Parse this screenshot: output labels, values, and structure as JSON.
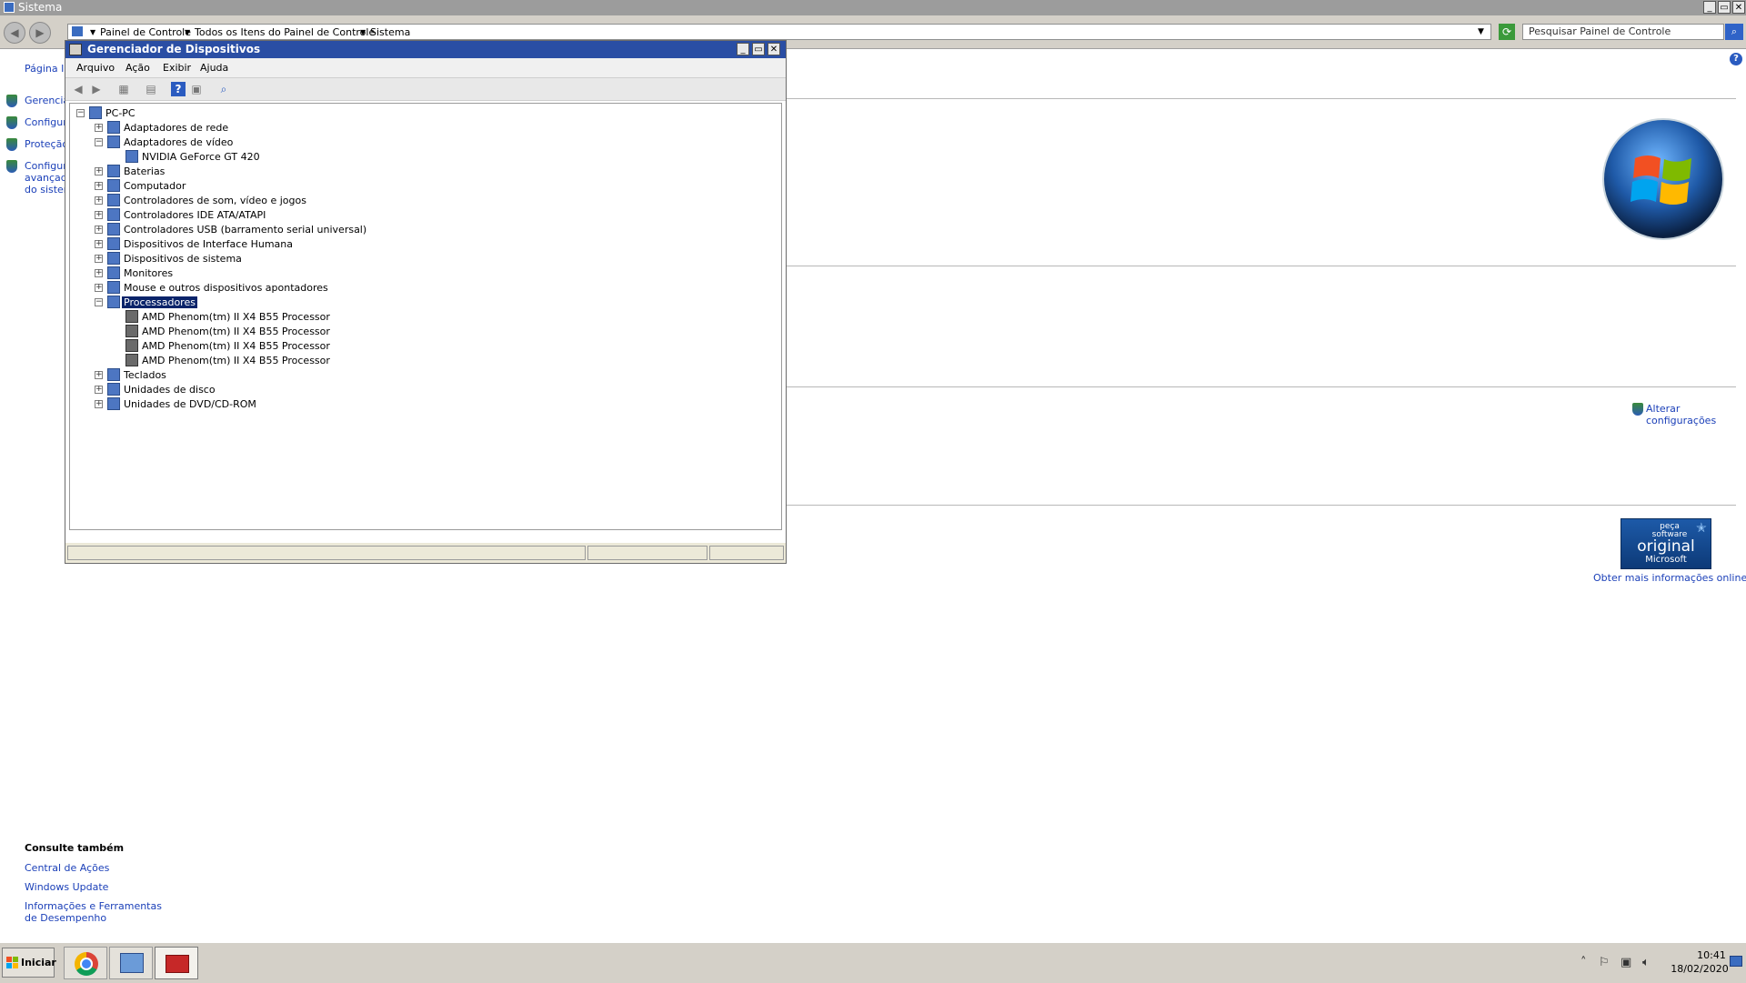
{
  "window": {
    "title": "Sistema",
    "min": "_",
    "max": "▭",
    "close": "✕"
  },
  "addressbar": {
    "back": "◀",
    "forward": "▶",
    "crumbs": [
      "Painel de Controle",
      "Todos os Itens do Painel de Controle",
      "Sistema"
    ],
    "search_placeholder": "Pesquisar Painel de Controle"
  },
  "sidebar": {
    "home": "Página Inicial do Painel de Controle",
    "items": [
      {
        "label": "Gerenciador de Dispositivos"
      },
      {
        "label": "Configurações remotas"
      },
      {
        "label": "Proteção do sistema"
      },
      {
        "label": "Configurações avançadas do sistema"
      }
    ]
  },
  "seealso": {
    "heading": "Consulte também",
    "links": [
      "Central de Ações",
      "Windows Update",
      "Informações e Ferramentas de Desempenho"
    ]
  },
  "right": {
    "change_settings": "Alterar configurações",
    "genuine_top": "peça software",
    "genuine_main": "original",
    "genuine_brand": "Microsoft",
    "more_info": "Obter mais informações online..."
  },
  "devmgr": {
    "title": "Gerenciador de Dispositivos",
    "menus": [
      "Arquivo",
      "Ação",
      "Exibir",
      "Ajuda"
    ],
    "tree": [
      {
        "label": "PC-PC",
        "level": 0,
        "exp": "−"
      },
      {
        "label": "Adaptadores de rede",
        "level": 1,
        "exp": "+"
      },
      {
        "label": "Adaptadores de vídeo",
        "level": 1,
        "exp": "−"
      },
      {
        "label": "NVIDIA GeForce GT 420",
        "level": 2,
        "exp": ""
      },
      {
        "label": "Baterias",
        "level": 1,
        "exp": "+"
      },
      {
        "label": "Computador",
        "level": 1,
        "exp": "+"
      },
      {
        "label": "Controladores de som, vídeo e jogos",
        "level": 1,
        "exp": "+"
      },
      {
        "label": "Controladores IDE ATA/ATAPI",
        "level": 1,
        "exp": "+"
      },
      {
        "label": "Controladores USB (barramento serial universal)",
        "level": 1,
        "exp": "+"
      },
      {
        "label": "Dispositivos de Interface Humana",
        "level": 1,
        "exp": "+"
      },
      {
        "label": "Dispositivos de sistema",
        "level": 1,
        "exp": "+"
      },
      {
        "label": "Monitores",
        "level": 1,
        "exp": "+"
      },
      {
        "label": "Mouse e outros dispositivos apontadores",
        "level": 1,
        "exp": "+"
      },
      {
        "label": "Processadores",
        "level": 1,
        "exp": "−",
        "selected": true
      },
      {
        "label": "AMD Phenom(tm) II X4 B55 Processor",
        "level": 2,
        "exp": ""
      },
      {
        "label": "AMD Phenom(tm) II X4 B55 Processor",
        "level": 2,
        "exp": ""
      },
      {
        "label": "AMD Phenom(tm) II X4 B55 Processor",
        "level": 2,
        "exp": ""
      },
      {
        "label": "AMD Phenom(tm) II X4 B55 Processor",
        "level": 2,
        "exp": ""
      },
      {
        "label": "Teclados",
        "level": 1,
        "exp": "+"
      },
      {
        "label": "Unidades de disco",
        "level": 1,
        "exp": "+"
      },
      {
        "label": "Unidades de DVD/CD-ROM",
        "level": 1,
        "exp": "+"
      }
    ]
  },
  "taskbar": {
    "start": "Iniciar",
    "time": "10:41",
    "date": "18/02/2020"
  }
}
